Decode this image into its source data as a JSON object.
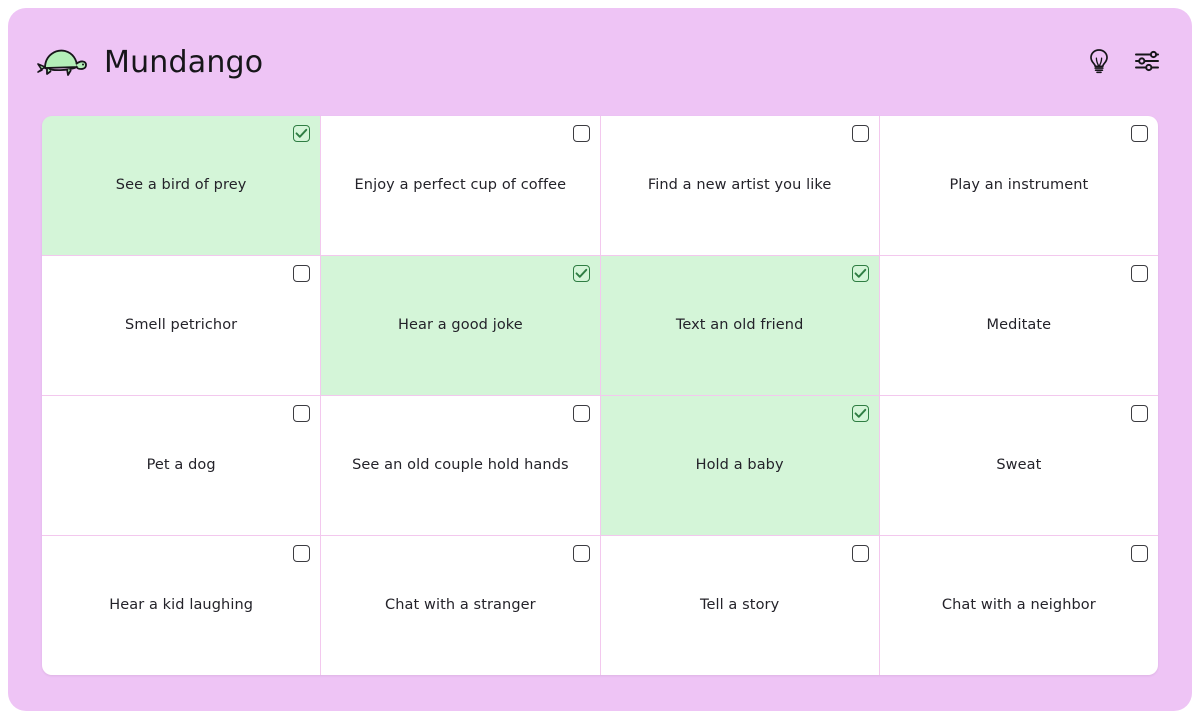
{
  "app": {
    "brand_name": "Mundango",
    "logo_icon": "turtle-icon",
    "background_color": "#eec4f5",
    "accent_checked_color": "#d4f5d8",
    "grid_line_color": "#f3c8ee"
  },
  "header": {
    "actions": [
      {
        "icon": "lightbulb-icon",
        "name": "ideas-button"
      },
      {
        "icon": "sliders-icon",
        "name": "settings-button"
      }
    ]
  },
  "grid": {
    "columns": 4,
    "rows": 4,
    "cells": [
      {
        "label": "See a bird of prey",
        "checked": true
      },
      {
        "label": "Enjoy a perfect cup of coffee",
        "checked": false
      },
      {
        "label": "Find a new artist you like",
        "checked": false
      },
      {
        "label": "Play an instrument",
        "checked": false
      },
      {
        "label": "Smell petrichor",
        "checked": false
      },
      {
        "label": "Hear a good joke",
        "checked": true
      },
      {
        "label": "Text an old friend",
        "checked": true
      },
      {
        "label": "Meditate",
        "checked": false
      },
      {
        "label": "Pet a dog",
        "checked": false
      },
      {
        "label": "See an old couple hold hands",
        "checked": false
      },
      {
        "label": "Hold a baby",
        "checked": true
      },
      {
        "label": "Sweat",
        "checked": false
      },
      {
        "label": "Hear a kid laughing",
        "checked": false
      },
      {
        "label": "Chat with a stranger",
        "checked": false
      },
      {
        "label": "Tell a story",
        "checked": false
      },
      {
        "label": "Chat with a neighbor",
        "checked": false
      }
    ]
  }
}
